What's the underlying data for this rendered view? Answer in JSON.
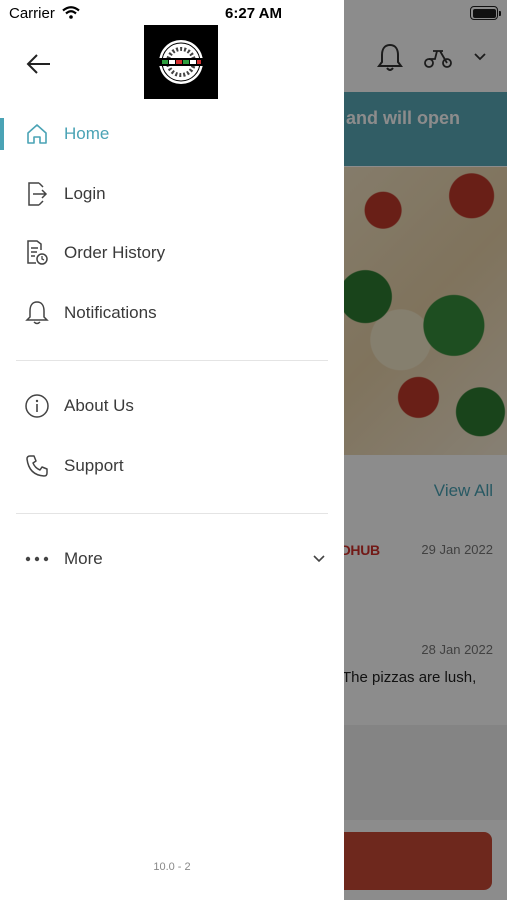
{
  "status_bar": {
    "carrier": "Carrier",
    "time": "6:27 AM"
  },
  "background": {
    "banner_text": "d and will open",
    "view_all": "View All",
    "brand_text": "ODHUB",
    "reviews": [
      {
        "date": "29 Jan 2022"
      },
      {
        "date": "28 Jan 2022",
        "text": "The pizzas are lush,"
      }
    ]
  },
  "drawer": {
    "menu": [
      {
        "label": "Home",
        "icon": "home-icon",
        "active": true
      },
      {
        "label": "Login",
        "icon": "login-icon"
      },
      {
        "label": "Order History",
        "icon": "order-history-icon"
      },
      {
        "label": "Notifications",
        "icon": "bell-icon"
      }
    ],
    "secondary": [
      {
        "label": "About Us",
        "icon": "info-icon"
      },
      {
        "label": "Support",
        "icon": "phone-icon"
      }
    ],
    "more": {
      "label": "More",
      "icon": "more-dots-icon"
    },
    "version": "10.0 - 2"
  },
  "colors": {
    "accent": "#4aa3b5",
    "text": "#3a3a3a",
    "cta": "#c94a35"
  }
}
